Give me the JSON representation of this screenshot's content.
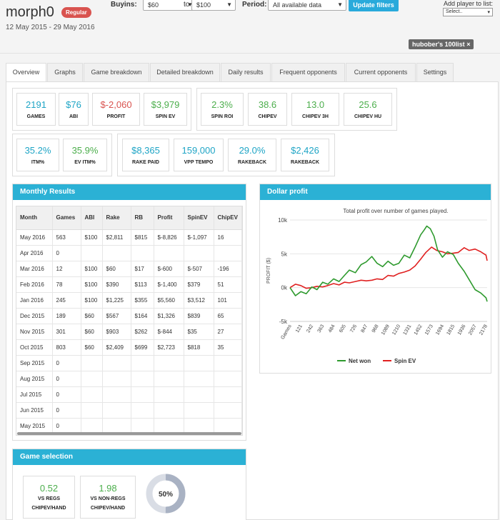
{
  "player": {
    "name": "morph0",
    "badge": "Regular",
    "dates": "12 May 2015 - 29 May 2016"
  },
  "filters": {
    "buyins_label": "Buyins:",
    "buyin_from": "$60",
    "to_label": "to",
    "buyin_to": "$100",
    "period_label": "Period:",
    "period_value": "All available data",
    "update_button": "Update filters",
    "add_list_label": "Add player to list:",
    "add_list_value": "Select.."
  },
  "list_tag": "hubober's 100list",
  "tabs": [
    "Overview",
    "Graphs",
    "Game breakdown",
    "Detailed breakdown",
    "Daily results",
    "Frequent opponents",
    "Current opponents",
    "Settings"
  ],
  "stats_row1": [
    {
      "value": "2191",
      "label": "GAMES",
      "color": "teal"
    },
    {
      "value": "$76",
      "label": "ABI",
      "color": "teal"
    },
    {
      "value": "$-2,060",
      "label": "PROFIT",
      "color": "red"
    },
    {
      "value": "$3,979",
      "label": "SPIN EV",
      "color": "green"
    },
    {
      "value": "2.3%",
      "label": "SPIN ROI",
      "color": "green"
    },
    {
      "value": "38.6",
      "label": "CHIPEV",
      "color": "green"
    },
    {
      "value": "13.0",
      "label": "CHIPEV 3H",
      "color": "green"
    },
    {
      "value": "25.6",
      "label": "CHIPEV HU",
      "color": "green"
    }
  ],
  "stats_row2": [
    {
      "value": "35.2%",
      "label": "ITM%",
      "color": "teal"
    },
    {
      "value": "35.9%",
      "label": "EV ITM%",
      "color": "green"
    },
    {
      "value": "$8,365",
      "label": "RAKE PAID",
      "color": "teal"
    },
    {
      "value": "159,000",
      "label": "VPP TEMPO",
      "color": "teal"
    },
    {
      "value": "29.0%",
      "label": "RAKEBACK",
      "color": "teal"
    },
    {
      "value": "$2,426",
      "label": "RAKEBACK",
      "color": "teal"
    }
  ],
  "monthly": {
    "title": "Monthly Results",
    "columns": [
      "Month",
      "Games",
      "ABI",
      "Rake",
      "RB",
      "Profit",
      "SpinEV",
      "ChipEV"
    ],
    "rows": [
      [
        "May 2016",
        "563",
        "$100",
        "$2,811",
        "$815",
        "$-8,826",
        "$-1,097",
        "16"
      ],
      [
        "Apr 2016",
        "0",
        "",
        "",
        "",
        "",
        "",
        ""
      ],
      [
        "Mar 2016",
        "12",
        "$100",
        "$60",
        "$17",
        "$-600",
        "$-507",
        "-196"
      ],
      [
        "Feb 2016",
        "78",
        "$100",
        "$390",
        "$113",
        "$-1,400",
        "$379",
        "51"
      ],
      [
        "Jan 2016",
        "245",
        "$100",
        "$1,225",
        "$355",
        "$5,560",
        "$3,512",
        "101"
      ],
      [
        "Dec 2015",
        "189",
        "$60",
        "$567",
        "$164",
        "$1,326",
        "$839",
        "65"
      ],
      [
        "Nov 2015",
        "301",
        "$60",
        "$903",
        "$262",
        "$-844",
        "$35",
        "27"
      ],
      [
        "Oct 2015",
        "803",
        "$60",
        "$2,409",
        "$699",
        "$2,723",
        "$818",
        "35"
      ],
      [
        "Sep 2015",
        "0",
        "",
        "",
        "",
        "",
        "",
        ""
      ],
      [
        "Aug 2015",
        "0",
        "",
        "",
        "",
        "",
        "",
        ""
      ],
      [
        "Jul 2015",
        "0",
        "",
        "",
        "",
        "",
        "",
        ""
      ],
      [
        "Jun 2015",
        "0",
        "",
        "",
        "",
        "",
        "",
        ""
      ],
      [
        "May 2015",
        "0",
        "",
        "",
        "",
        "",
        "",
        ""
      ]
    ]
  },
  "chart_panel_title": "Dollar profit",
  "chart_data": {
    "type": "line",
    "title": "Total profit over number of games played.",
    "ylabel": "PROFIT ($)",
    "xlabel": "",
    "ylim": [
      -5000,
      10000
    ],
    "yticks": [
      "10k",
      "5k",
      "0k",
      "-5k"
    ],
    "xticks": [
      "Games",
      "121",
      "242",
      "363",
      "484",
      "605",
      "726",
      "847",
      "968",
      "1089",
      "1210",
      "1331",
      "1452",
      "1573",
      "1694",
      "1815",
      "1936",
      "2057",
      "2178"
    ],
    "series": [
      {
        "name": "Net won",
        "color": "#2e9a2e",
        "x": [
          0,
          60,
          121,
          180,
          242,
          300,
          363,
          420,
          484,
          545,
          605,
          660,
          726,
          790,
          847,
          910,
          968,
          1030,
          1089,
          1150,
          1210,
          1270,
          1331,
          1390,
          1452,
          1490,
          1520,
          1560,
          1600,
          1640,
          1694,
          1750,
          1815,
          1870,
          1936,
          1990,
          2057,
          2120,
          2178,
          2191
        ],
        "values": [
          0,
          -1200,
          -600,
          -900,
          100,
          -300,
          800,
          500,
          1300,
          900,
          1800,
          2600,
          2200,
          3400,
          3800,
          4600,
          3600,
          3100,
          3900,
          3300,
          3600,
          4800,
          4400,
          6000,
          7800,
          8500,
          9100,
          8700,
          7600,
          5600,
          4500,
          5300,
          4900,
          3600,
          2400,
          1200,
          -300,
          -800,
          -1500,
          -2060
        ]
      },
      {
        "name": "Spin EV",
        "color": "#e02020",
        "x": [
          0,
          60,
          121,
          180,
          242,
          300,
          363,
          420,
          484,
          545,
          605,
          660,
          726,
          790,
          847,
          910,
          968,
          1030,
          1089,
          1150,
          1210,
          1270,
          1331,
          1390,
          1452,
          1510,
          1573,
          1630,
          1694,
          1750,
          1815,
          1870,
          1936,
          1990,
          2057,
          2120,
          2178,
          2191
        ],
        "values": [
          0,
          500,
          300,
          -100,
          0,
          200,
          100,
          300,
          600,
          400,
          800,
          700,
          900,
          1100,
          1000,
          1100,
          1300,
          1200,
          1800,
          1700,
          2100,
          2300,
          2600,
          3200,
          4200,
          5200,
          6000,
          5500,
          5300,
          5000,
          5100,
          5200,
          5900,
          5500,
          5700,
          5300,
          4800,
          3979
        ]
      }
    ],
    "legend": "bottom"
  },
  "game_selection": {
    "title": "Game selection",
    "boxes": [
      {
        "value": "0.52",
        "label1": "VS REGS",
        "label2": "CHIPEV/HAND"
      },
      {
        "value": "1.98",
        "label1": "VS NON-REGS",
        "label2": "CHIPEV/HAND"
      }
    ],
    "donut_value": "50%",
    "donut_fraction": 0.5
  }
}
